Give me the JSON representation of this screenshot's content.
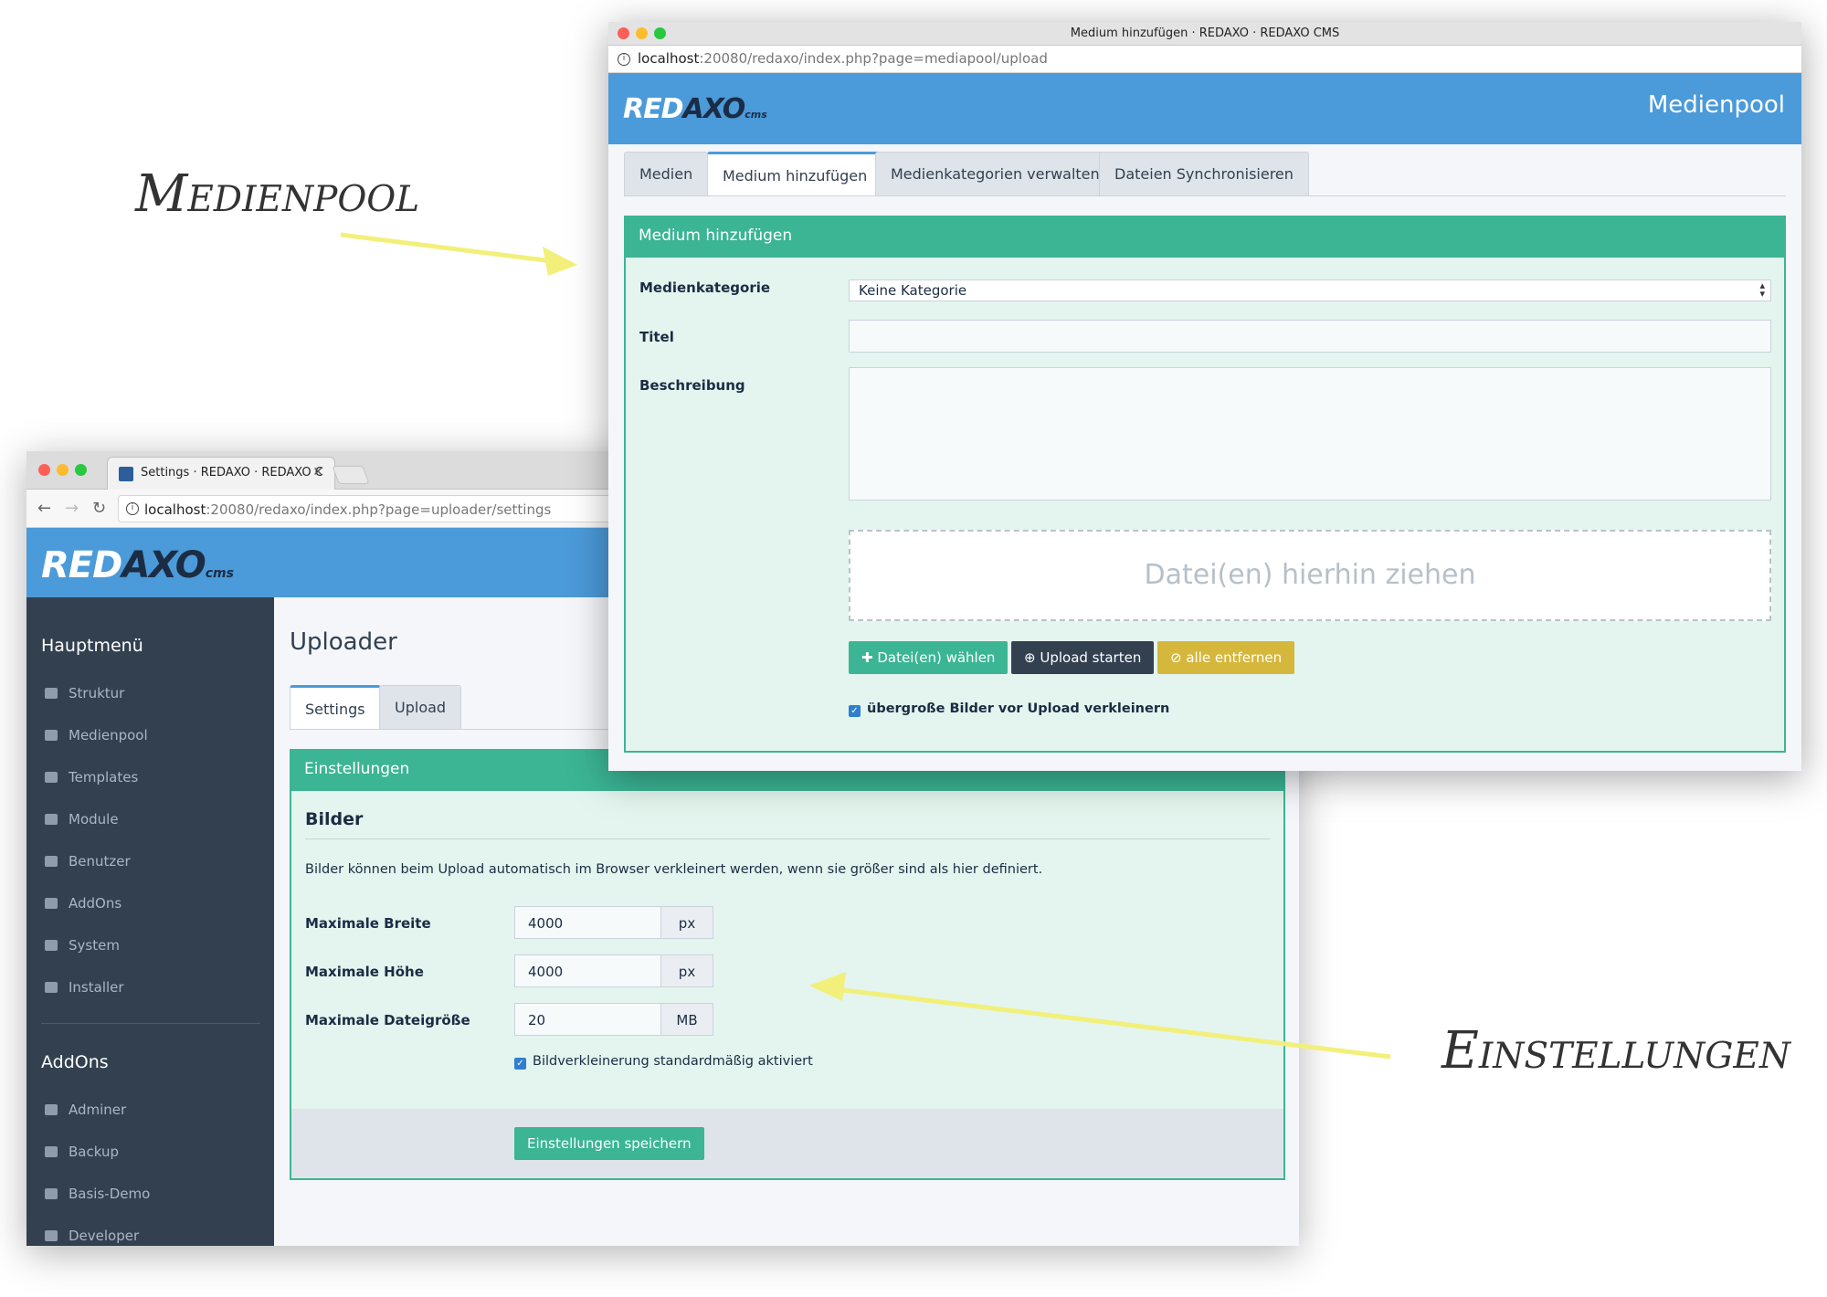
{
  "annotations": {
    "top": "Medienpool",
    "bottom": "Einstellungen"
  },
  "back_window": {
    "tab_title": "Settings · REDAXO · REDAXO C",
    "url_host": "localhost",
    "url_rest": ":20080/redaxo/index.php?page=uploader/settings",
    "logo_red": "RED",
    "logo_axo": "AXO",
    "logo_cms": "cms",
    "sidebar": {
      "main_title": "Hauptmenü",
      "main_items": [
        "Struktur",
        "Medienpool",
        "Templates",
        "Module",
        "Benutzer",
        "AddOns",
        "System",
        "Installer"
      ],
      "addons_title": "AddOns",
      "addon_items": [
        "Adminer",
        "Backup",
        "Basis-Demo",
        "Developer"
      ]
    },
    "page_title": "Uploader",
    "tabs": [
      "Settings",
      "Upload"
    ],
    "panel_title": "Einstellungen",
    "section_title": "Bilder",
    "section_desc": "Bilder können beim Upload automatisch im Browser verkleinert werden, wenn sie größer sind als hier definiert.",
    "fields": [
      {
        "label": "Maximale Breite",
        "value": "4000",
        "unit": "px"
      },
      {
        "label": "Maximale Höhe",
        "value": "4000",
        "unit": "px"
      },
      {
        "label": "Maximale Dateigröße",
        "value": "20",
        "unit": "MB"
      }
    ],
    "checkbox_label": "Bildverkleinerung standardmäßig aktiviert",
    "save_button": "Einstellungen speichern"
  },
  "front_window": {
    "window_title": "Medium hinzufügen · REDAXO · REDAXO CMS",
    "url_host": "localhost",
    "url_rest": ":20080/redaxo/index.php?page=mediapool/upload",
    "logo_red": "RED",
    "logo_axo": "AXO",
    "logo_cms": "cms",
    "header_title": "Medienpool",
    "tabs": [
      "Medien",
      "Medium hinzufügen",
      "Medienkategorien verwalten",
      "Dateien Synchronisieren"
    ],
    "panel_title": "Medium hinzufügen",
    "category_label": "Medienkategorie",
    "category_value": "Keine Kategorie",
    "title_label": "Titel",
    "title_value": "",
    "description_label": "Beschreibung",
    "description_value": "",
    "dropzone_text": "Datei(en) hierhin ziehen",
    "btn_choose": "Datei(en) wählen",
    "btn_upload": "Upload starten",
    "btn_remove": "alle entfernen",
    "checkbox_label": "übergroße Bilder vor Upload verkleinern"
  },
  "colors": {
    "header_blue": "#4b9ad9",
    "sidebar_dark": "#324050",
    "panel_green": "#3bb594",
    "panel_bg": "#e3f5ee",
    "upload_btn_dark": "#324050",
    "remove_btn_yellow": "#d5b73c",
    "arrow_yellow": "#f2f07a"
  }
}
